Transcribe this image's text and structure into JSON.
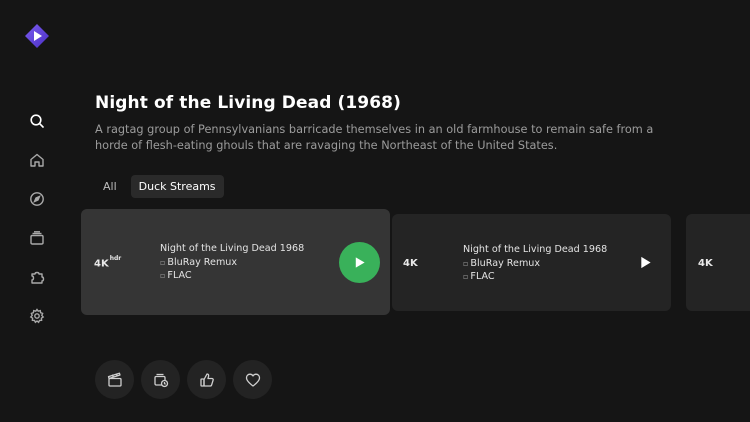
{
  "app": {
    "logo_icon": "stremio-logo-icon",
    "accent": "#39b15a"
  },
  "sidebar": {
    "items": [
      {
        "icon": "search-icon",
        "active": true
      },
      {
        "icon": "home-icon"
      },
      {
        "icon": "compass-icon"
      },
      {
        "icon": "library-icon"
      },
      {
        "icon": "puzzle-icon"
      },
      {
        "icon": "settings-icon"
      }
    ]
  },
  "movie": {
    "title": "Night of the Living Dead (1968)",
    "description": "A ragtag group of Pennsylvanians barricade themselves in an old farmhouse to remain safe from a horde of flesh-eating ghouls that are ravaging the Northeast of the United States."
  },
  "tabs": [
    {
      "label": "All",
      "active": false
    },
    {
      "label": "Duck Streams",
      "active": true
    }
  ],
  "streams": [
    {
      "quality": "4K",
      "quality_sup": "hdr",
      "name": "Night of the Living Dead 1968",
      "source": "BluRay Remux",
      "audio": "FLAC"
    },
    {
      "quality": "4K",
      "name": "Night of the Living Dead 1968",
      "source": "BluRay Remux",
      "audio": "FLAC"
    },
    {
      "quality": "4K"
    }
  ],
  "actions": [
    {
      "icon": "trailer-icon"
    },
    {
      "icon": "watched-icon"
    },
    {
      "icon": "like-icon"
    },
    {
      "icon": "heart-icon"
    }
  ]
}
